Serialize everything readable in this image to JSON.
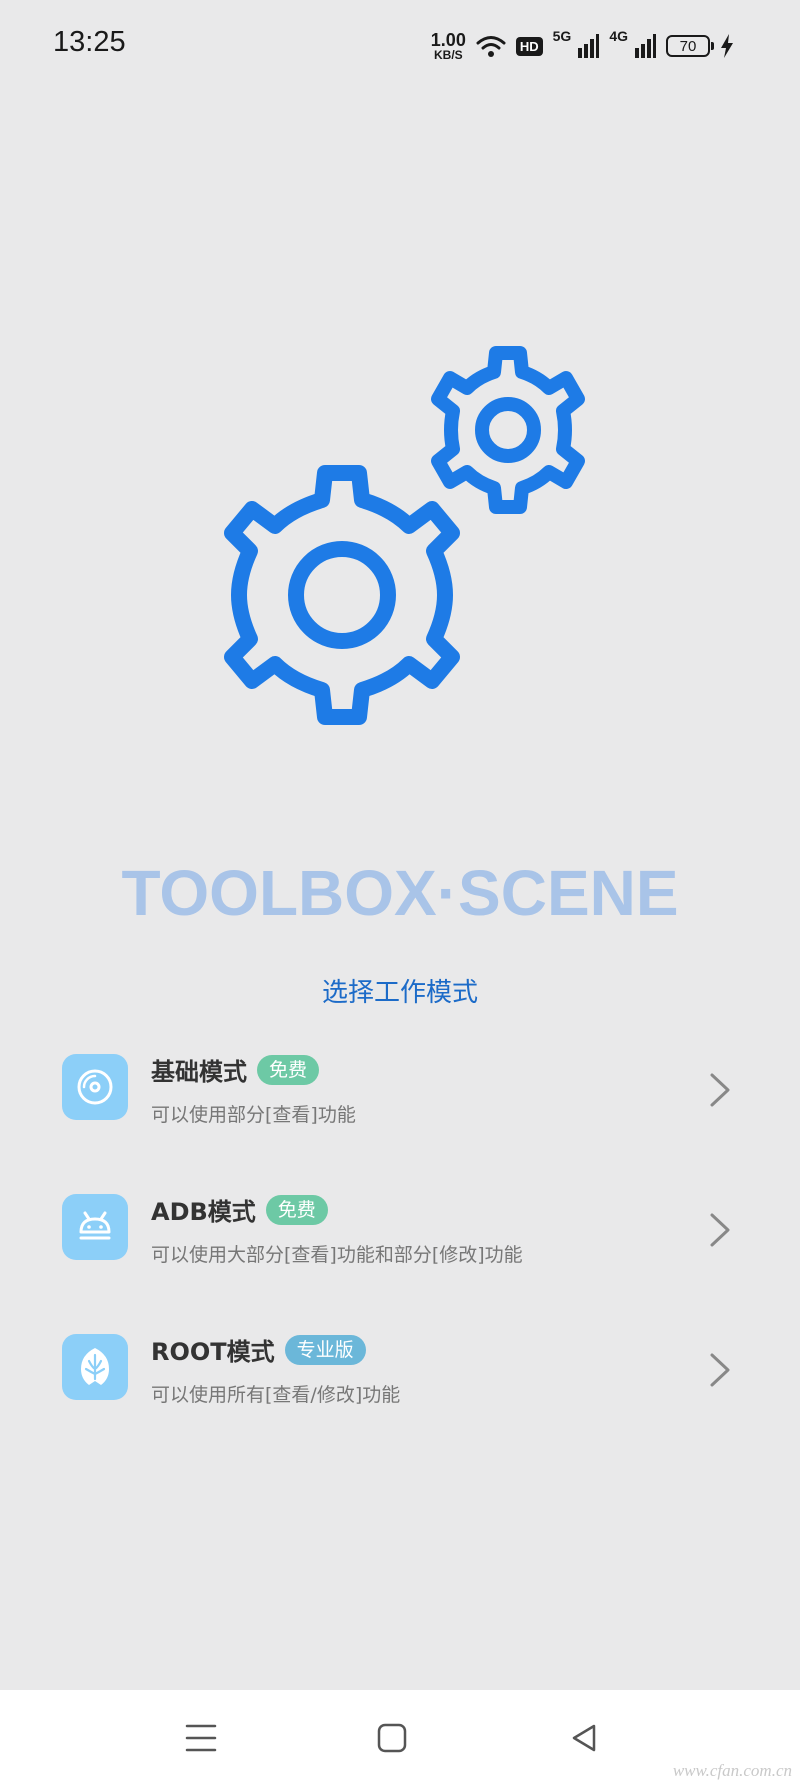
{
  "status_bar": {
    "time": "13:25",
    "net_speed_value": "1.00",
    "net_speed_unit": "KB/S",
    "hd_label": "HD",
    "sig1_label": "5G",
    "sig2_label": "4G",
    "battery_level": "70"
  },
  "app": {
    "title": "TOOLBOX·SCENE",
    "subtitle": "选择工作模式"
  },
  "modes": [
    {
      "title": "基础模式",
      "badge": "免费",
      "description": "可以使用部分[查看]功能"
    },
    {
      "title": "ADB模式",
      "badge": "免费",
      "description": "可以使用大部分[查看]功能和部分[修改]功能"
    },
    {
      "title": "ROOT模式",
      "badge": "专业版",
      "description": "可以使用所有[查看/修改]功能"
    }
  ],
  "colors": {
    "accent_blue": "#1c6bc8",
    "gear_blue": "#1e7be6",
    "title_light_blue": "#a9c4e8",
    "badge_free": "#6dc9a5",
    "badge_pro": "#6bb7d9",
    "mode_icon_bg": "#8ccff8"
  },
  "watermark": "www.cfan.com.cn",
  "icons": {
    "mode_basic": "disc-icon",
    "mode_adb": "android-icon",
    "mode_root": "magisk-icon"
  }
}
